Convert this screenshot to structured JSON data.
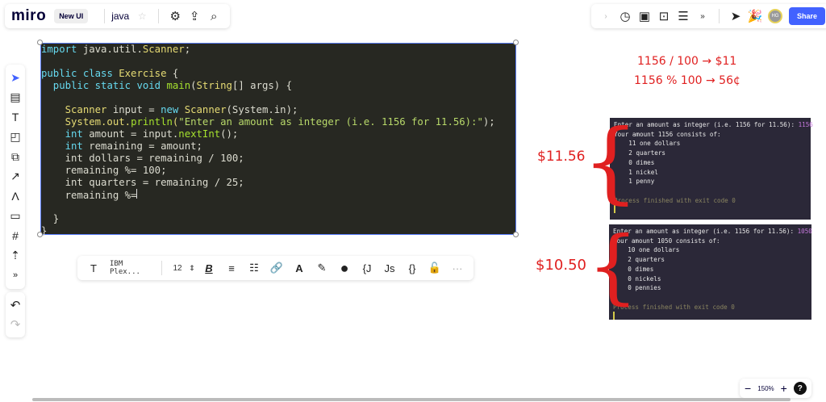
{
  "topbar": {
    "logo": "miro",
    "badge": "New UI",
    "board_name": "java",
    "share_label": "Share",
    "avatar_initials": "HG"
  },
  "left_toolbar": [
    "cursor-icon",
    "templates-icon",
    "text-icon",
    "sticky-note-icon",
    "shapes-icon",
    "arrow-icon",
    "pen-icon",
    "comment-icon",
    "frame-icon",
    "upload-icon",
    "more-icon"
  ],
  "code": {
    "lines": [
      [
        [
          "import ",
          "kw"
        ],
        [
          "java.util.",
          "pl"
        ],
        [
          "Scanner",
          "ty"
        ],
        [
          ";",
          "pl"
        ]
      ],
      [],
      [
        [
          "public ",
          "kw"
        ],
        [
          "class ",
          "kw"
        ],
        [
          "Exercise ",
          "ty"
        ],
        [
          "{",
          "pl"
        ]
      ],
      [
        [
          "  public ",
          "kw"
        ],
        [
          "static ",
          "kw"
        ],
        [
          "void ",
          "kw"
        ],
        [
          "main",
          "fn"
        ],
        [
          "(",
          "pl"
        ],
        [
          "String",
          "ty"
        ],
        [
          "[] args) {",
          "pl"
        ]
      ],
      [],
      [
        [
          "    Scanner ",
          "ty"
        ],
        [
          "input = ",
          "pl"
        ],
        [
          "new ",
          "kw"
        ],
        [
          "Scanner",
          "ty"
        ],
        [
          "(System.in);",
          "pl"
        ]
      ],
      [
        [
          "    System.out.",
          "ty"
        ],
        [
          "println",
          "fn"
        ],
        [
          "(",
          "ty"
        ],
        [
          "\"Enter an amount as integer (i.e. 1156 for 11.56):\"",
          "st"
        ],
        [
          ");",
          "pl"
        ]
      ],
      [
        [
          "    int ",
          "kw"
        ],
        [
          "amount = input.",
          "pl"
        ],
        [
          "nextInt",
          "fn"
        ],
        [
          "();",
          "pl"
        ]
      ],
      [
        [
          "    int ",
          "kw"
        ],
        [
          "remaining = amount;",
          "pl"
        ]
      ],
      [
        [
          "    int dollars = remaining / 100;",
          "pl"
        ]
      ],
      [
        [
          "    remaining %= 100;",
          "pl"
        ]
      ],
      [
        [
          "    int quarters = remaining / 25;",
          "pl"
        ]
      ],
      [
        [
          "    remaining %=",
          "pl"
        ]
      ],
      [],
      [
        [
          "  }",
          "pl"
        ]
      ],
      [
        [
          "}",
          "pl"
        ]
      ]
    ]
  },
  "format_toolbar": {
    "font": "IBM Plex...",
    "size": "12"
  },
  "terminal1": {
    "prompt": "Enter an amount as integer (i.e. 1156 for 11.56): ",
    "input": "1156",
    "lines": [
      "Your amount 1156 consists of:",
      "    11 one dollars",
      "    2 quarters",
      "    0 dimes",
      "    1 nickel",
      "    1 penny"
    ],
    "exit": "Process finished with exit code 0"
  },
  "terminal2": {
    "prompt": "Enter an amount as integer (i.e. 1156 for 11.56): ",
    "input": "1050",
    "lines": [
      "Your amount 1050 consists of:",
      "    10 one dollars",
      "    2 quarters",
      "    0 dimes",
      "    0 nickels",
      "    0 pennies"
    ],
    "exit": "Process finished with exit code 0"
  },
  "annotations": {
    "line1": "1156 / 100 → $11",
    "line2": "1156 % 100 → 56¢",
    "label1": "$11.56",
    "label2": "$10.50"
  },
  "zoom": {
    "level": "150%",
    "help": "?"
  },
  "colors": {
    "accent": "#4262ff",
    "annotation": "#e02020",
    "code_bg": "#272822",
    "terminal_bg": "#2b2838"
  }
}
